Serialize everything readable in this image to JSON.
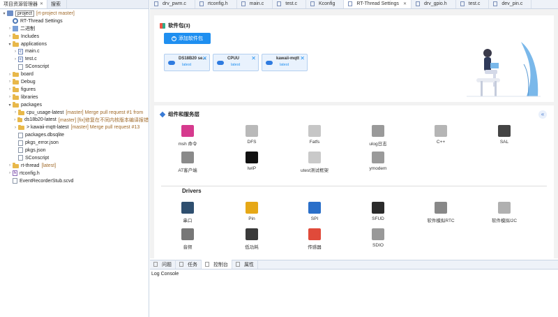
{
  "left_panel": {
    "tabs": [
      {
        "label": "项目资源管理器",
        "close": "✕"
      },
      {
        "label": "搜索",
        "close": ""
      }
    ],
    "tree": [
      {
        "label": "project",
        "git": "[rt-project master]",
        "indent": 0,
        "arrow": "▾",
        "icon": "proj"
      },
      {
        "label": "RT-Thread Settings",
        "git": "",
        "indent": 1,
        "arrow": "",
        "icon": "gear"
      },
      {
        "label": "二进制",
        "git": "",
        "indent": 1,
        "arrow": "›",
        "icon": "bin"
      },
      {
        "label": "Includes",
        "git": "",
        "indent": 1,
        "arrow": "›",
        "icon": "folder"
      },
      {
        "label": "applications",
        "git": "",
        "indent": 1,
        "arrow": "▾",
        "icon": "folder"
      },
      {
        "label": "main.c",
        "git": "",
        "indent": 2,
        "arrow": "›",
        "icon": "cfile"
      },
      {
        "label": "test.c",
        "git": "",
        "indent": 2,
        "arrow": "›",
        "icon": "cfile"
      },
      {
        "label": "SConscript",
        "git": "",
        "indent": 2,
        "arrow": "",
        "icon": "file"
      },
      {
        "label": "board",
        "git": "",
        "indent": 1,
        "arrow": "›",
        "icon": "folder"
      },
      {
        "label": "Debug",
        "git": "",
        "indent": 1,
        "arrow": "›",
        "icon": "folder"
      },
      {
        "label": "figures",
        "git": "",
        "indent": 1,
        "arrow": "›",
        "icon": "folder"
      },
      {
        "label": "libraries",
        "git": "",
        "indent": 1,
        "arrow": "›",
        "icon": "folder"
      },
      {
        "label": "packages",
        "git": "",
        "indent": 1,
        "arrow": "▾",
        "icon": "folder"
      },
      {
        "label": "cpu_usage-latest",
        "git": "[master] Merge pull request #1 from",
        "indent": 2,
        "arrow": "›",
        "icon": "folder"
      },
      {
        "label": "ds18b20-latest",
        "git": "[master] [fix]修复在不同内核版本编译报错",
        "indent": 2,
        "arrow": "›",
        "icon": "folder"
      },
      {
        "label": "> kawaii-mqtt-latest",
        "git": "[master] Merge pull request #13",
        "indent": 2,
        "arrow": "›",
        "icon": "folder"
      },
      {
        "label": "packages.dbsqlite",
        "git": "",
        "indent": 2,
        "arrow": "",
        "icon": "file"
      },
      {
        "label": "pkgs_error.json",
        "git": "",
        "indent": 2,
        "arrow": "",
        "icon": "file"
      },
      {
        "label": "pkgs.json",
        "git": "",
        "indent": 2,
        "arrow": "",
        "icon": "file"
      },
      {
        "label": "SConscript",
        "git": "",
        "indent": 2,
        "arrow": "",
        "icon": "file"
      },
      {
        "label": "rt-thread",
        "git": "[latest]",
        "indent": 1,
        "arrow": "›",
        "icon": "folder"
      },
      {
        "label": "rtconfig.h",
        "git": "",
        "indent": 1,
        "arrow": "›",
        "icon": "hfile"
      },
      {
        "label": "EventRecorderStub.scvd",
        "git": "",
        "indent": 1,
        "arrow": "",
        "icon": "file"
      }
    ]
  },
  "editor": {
    "tabs": [
      {
        "label": "drv_pwm.c",
        "close": "",
        "active": false
      },
      {
        "label": "rtconfig.h",
        "close": "",
        "active": false
      },
      {
        "label": "main.c",
        "close": "",
        "active": false
      },
      {
        "label": "test.c",
        "close": "",
        "active": false
      },
      {
        "label": "Kconfig",
        "close": "",
        "active": false
      },
      {
        "label": "RT-Thread Settings",
        "close": "✕",
        "active": true
      },
      {
        "label": "drv_gpio.h",
        "close": "",
        "active": false
      },
      {
        "label": "test.c",
        "close": "",
        "active": false
      },
      {
        "label": "dev_pin.c",
        "close": "",
        "active": false
      }
    ],
    "packages": {
      "title": "软件包(3)",
      "add_button": "添加软件包",
      "items": [
        {
          "name": "DS18B20 se...",
          "version": "latest"
        },
        {
          "name": "CPUU",
          "version": "latest"
        },
        {
          "name": "kawaii-mqtt",
          "version": "latest"
        }
      ]
    },
    "components": {
      "title": "组件和服务层",
      "collapse": "«",
      "items": [
        {
          "label": "msh 命令",
          "icon": "terminal-icon",
          "color": "#d63a8e"
        },
        {
          "label": "DFS",
          "icon": "folder-icon",
          "color": "#b9b9b9"
        },
        {
          "label": "Fatfs",
          "icon": "fat-icon",
          "color": "#c6c6c6"
        },
        {
          "label": "ulog日志",
          "icon": "log-icon",
          "color": "#9a9a9a"
        },
        {
          "label": "C++",
          "icon": "cpp-icon",
          "color": "#b5b5b5"
        },
        {
          "label": "SAL",
          "icon": "router-icon",
          "color": "#444444"
        },
        {
          "label": "AT客户端",
          "icon": "at-icon",
          "color": "#8a8a8a"
        },
        {
          "label": "lwIP",
          "icon": "lwip-icon",
          "color": "#111111"
        },
        {
          "label": "utest测试框架",
          "icon": "flask-icon",
          "color": "#c9c9c9"
        },
        {
          "label": "ymodem",
          "icon": "phone-icon",
          "color": "#9a9a9a"
        }
      ]
    },
    "drivers": {
      "title": "Drivers",
      "items": [
        {
          "label": "串口",
          "icon": "serial-port-icon",
          "color": "#2f4f6f"
        },
        {
          "label": "Pin",
          "icon": "chip-icon",
          "color": "#e6a817"
        },
        {
          "label": "SPI",
          "icon": "spi-icon",
          "color": "#2a6fc9"
        },
        {
          "label": "SFUD",
          "icon": "flash-chip-icon",
          "color": "#2b2b2b"
        },
        {
          "label": "软件模拟RTC",
          "icon": "clock-icon",
          "color": "#888888"
        },
        {
          "label": "软件模拟I2C",
          "icon": "i2c-icon",
          "color": "#b0b0b0"
        },
        {
          "label": "音频",
          "icon": "headphones-icon",
          "color": "#777777"
        },
        {
          "label": "低功耗",
          "icon": "battery-icon",
          "color": "#3a3a3a"
        },
        {
          "label": "传感器",
          "icon": "thermometer-icon",
          "color": "#e04a3a"
        },
        {
          "label": "SDIO",
          "icon": "sd-card-icon",
          "color": "#999999"
        }
      ]
    }
  },
  "console": {
    "tabs": [
      {
        "label": "问题",
        "active": false
      },
      {
        "label": "任务",
        "active": false
      },
      {
        "label": "控制台",
        "active": true
      },
      {
        "label": "属性",
        "active": false
      }
    ],
    "label": "Log Console"
  }
}
